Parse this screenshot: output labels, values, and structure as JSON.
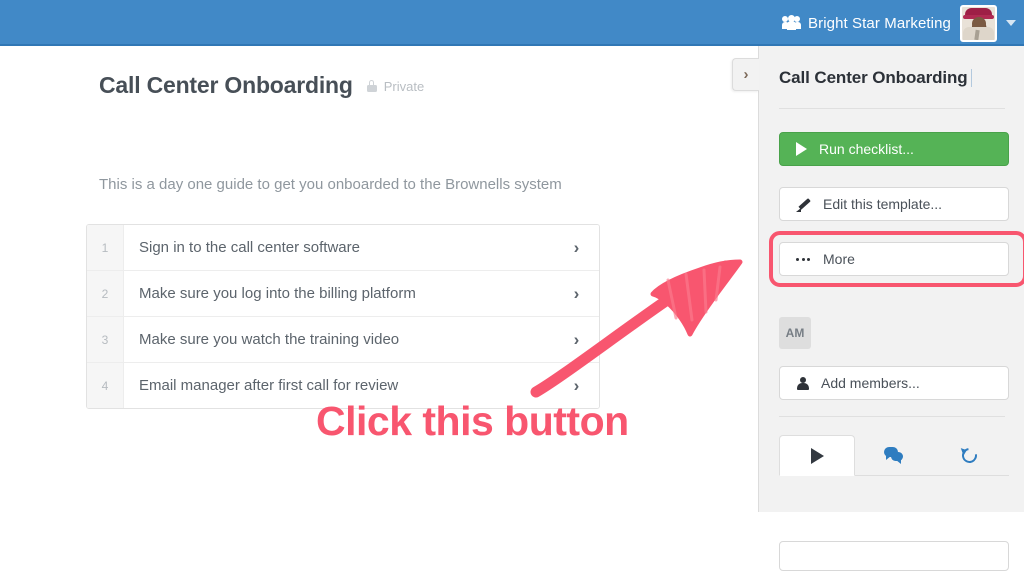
{
  "topbar": {
    "org_icon": "people-icon",
    "org_name": "Bright Star Marketing",
    "avatar_alt": "user-avatar",
    "caret_icon": "chevron-down-icon",
    "bg_color": "#4189C7"
  },
  "main": {
    "title": "Call Center Onboarding",
    "privacy_icon": "lock-icon",
    "privacy_label": "Private",
    "description": "This is a day one guide to get you onboarded to the Brownells system",
    "tasks": [
      {
        "number": "1",
        "text": "Sign in to the call center software",
        "arrow": "›"
      },
      {
        "number": "2",
        "text": "Make sure you log into the billing platform",
        "arrow": "›"
      },
      {
        "number": "3",
        "text": "Make sure you watch the training video",
        "arrow": "›"
      },
      {
        "number": "4",
        "text": "Email manager after first call for review",
        "arrow": "›"
      }
    ]
  },
  "sidebar": {
    "collapse_icon": "›",
    "title": "Call Center Onboarding",
    "run_checklist_label": "Run checklist...",
    "run_checklist_color": "#55b356",
    "edit_template_label": "Edit this template...",
    "more_label": "More",
    "member_initials": "AM",
    "add_members_label": "Add members...",
    "tabs": [
      {
        "icon": "play-icon",
        "active": true
      },
      {
        "icon": "comments-icon",
        "active": false
      },
      {
        "icon": "history-icon",
        "active": false
      }
    ]
  },
  "annotation": {
    "text": "Click this button",
    "color": "#f8566f",
    "arrow_icon": "hand-drawn-arrow",
    "highlight_target": "more-button"
  }
}
